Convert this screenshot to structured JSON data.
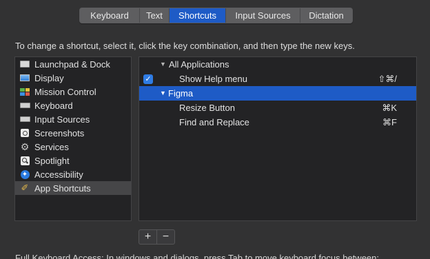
{
  "tabs": [
    {
      "label": "Keyboard",
      "selected": false
    },
    {
      "label": "Text",
      "selected": false
    },
    {
      "label": "Shortcuts",
      "selected": true
    },
    {
      "label": "Input Sources",
      "selected": false
    },
    {
      "label": "Dictation",
      "selected": false
    }
  ],
  "instruction": "To change a shortcut, select it, click the key combination, and then type the new keys.",
  "categories": [
    {
      "label": "Launchpad & Dock",
      "icon": "launchpad-icon"
    },
    {
      "label": "Display",
      "icon": "display-icon"
    },
    {
      "label": "Mission Control",
      "icon": "mission-control-icon"
    },
    {
      "label": "Keyboard",
      "icon": "keyboard-icon"
    },
    {
      "label": "Input Sources",
      "icon": "input-sources-icon"
    },
    {
      "label": "Screenshots",
      "icon": "screenshot-icon"
    },
    {
      "label": "Services",
      "icon": "gear-icon"
    },
    {
      "label": "Spotlight",
      "icon": "spotlight-icon"
    },
    {
      "label": "Accessibility",
      "icon": "accessibility-icon"
    },
    {
      "label": "App Shortcuts",
      "icon": "app-shortcuts-icon",
      "selected": true
    }
  ],
  "shortcuts": {
    "group_all": "All Applications",
    "show_help": {
      "label": "Show Help menu",
      "keys": "⇧⌘/",
      "checked": true
    },
    "group_figma": "Figma",
    "resize_button": {
      "label": "Resize Button",
      "keys": "⌘K"
    },
    "find_replace": {
      "label": "Find and Replace",
      "keys": "⌘F"
    }
  },
  "buttons": {
    "add": "+",
    "remove": "−"
  },
  "footer": "Full Keyboard Access: In windows and dialogs, press Tab to move keyboard focus between:",
  "colors": {
    "accent": "#1e5bc6",
    "background": "#323233",
    "list_bg": "#232325"
  }
}
